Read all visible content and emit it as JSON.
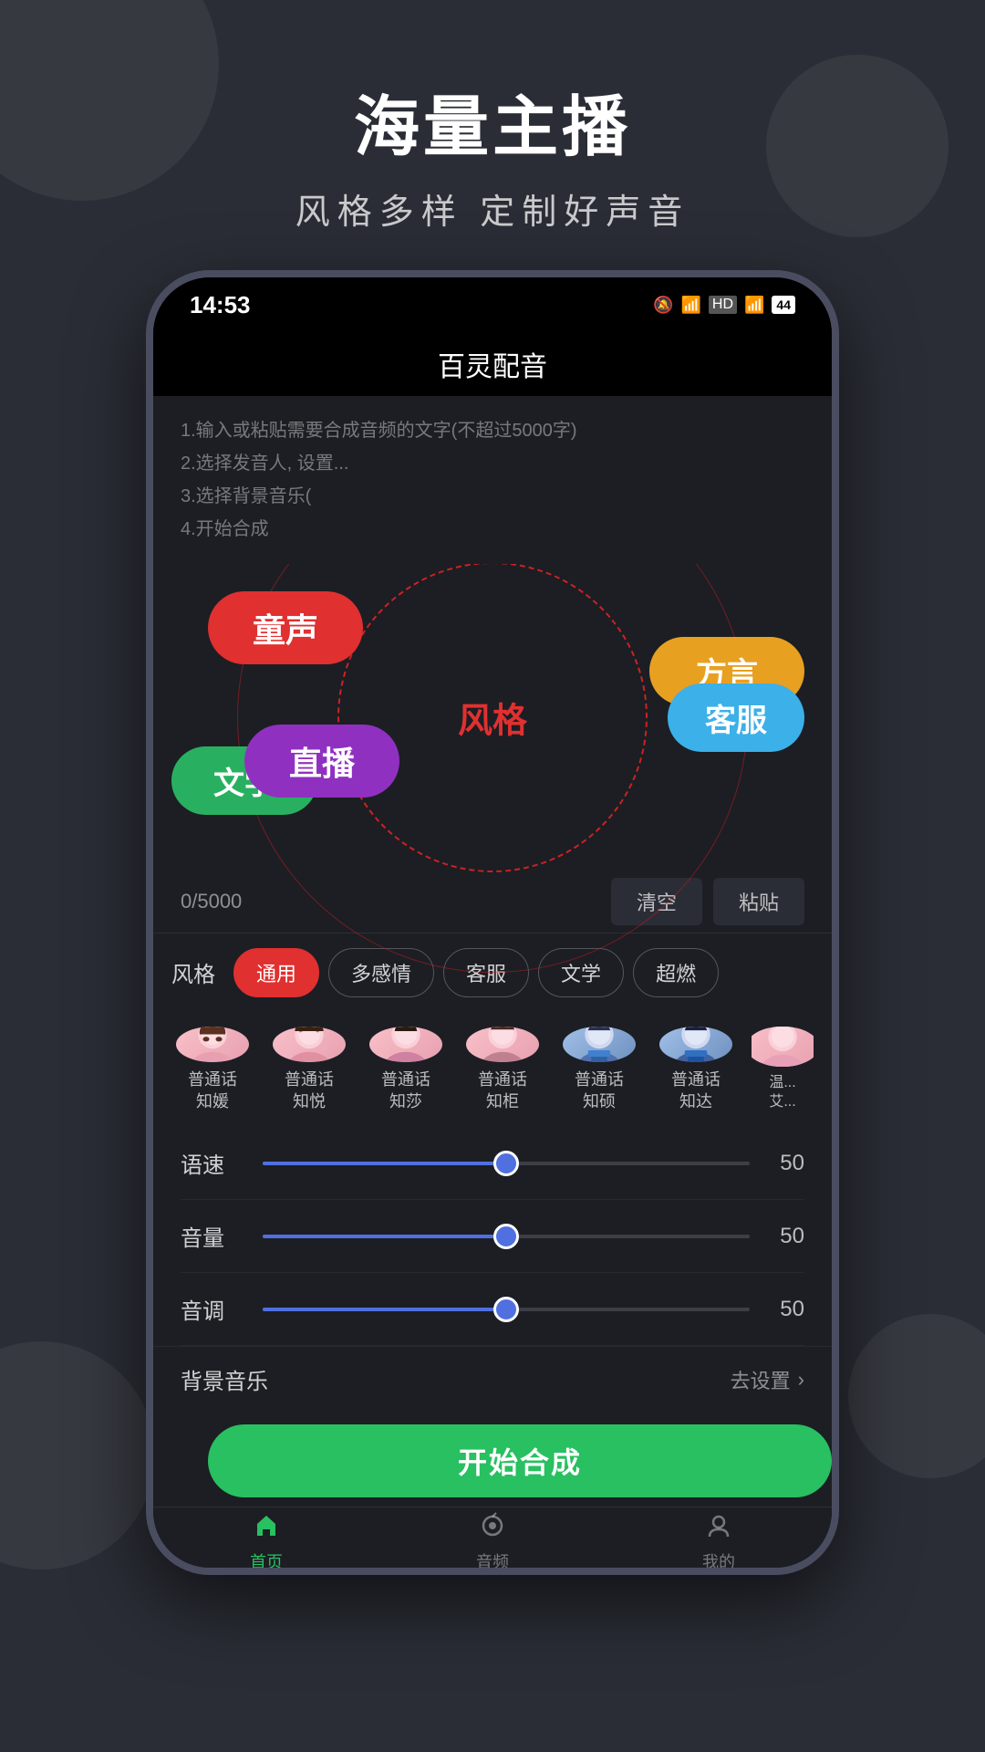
{
  "page": {
    "bg_title": "海量主播",
    "bg_subtitle": "风格多样  定制好声音"
  },
  "status_bar": {
    "time": "14:53",
    "icons": [
      "🔕",
      "📶",
      "HD",
      "4G",
      "44"
    ]
  },
  "app_header": {
    "title": "百灵配音"
  },
  "instructions": {
    "lines": [
      "1.输入或粘贴需要合成音频的文字(不超过5000字)",
      "2.选择发音人, 设...",
      "3.选择背景音乐(",
      "4.开始合成"
    ]
  },
  "style_wheel": {
    "center_label": "风格",
    "bubbles": [
      {
        "id": "tongsheng",
        "label": "童声",
        "color": "#e03030"
      },
      {
        "id": "fangyan",
        "label": "方言",
        "color": "#e8a020"
      },
      {
        "id": "wenxue",
        "label": "文学",
        "color": "#28b060"
      },
      {
        "id": "kefou",
        "label": "客服",
        "color": "#3cb0e8"
      },
      {
        "id": "zhibo",
        "label": "直播",
        "color": "#9030c0"
      }
    ]
  },
  "counter": {
    "value": "0/5000",
    "clear_label": "清空",
    "paste_label": "粘贴"
  },
  "style_filter": {
    "label": "风格",
    "chips": [
      {
        "id": "tongyong",
        "label": "通用",
        "active": true
      },
      {
        "id": "duogangqing",
        "label": "多感情",
        "active": false
      },
      {
        "id": "kefou",
        "label": "客服",
        "active": false
      },
      {
        "id": "wenxue",
        "label": "文学",
        "active": false
      },
      {
        "id": "chao",
        "label": "超燃",
        "active": false
      }
    ]
  },
  "voice_anchors": [
    {
      "id": "zhiyuan",
      "name": "普通话\n知媛",
      "gender": "female"
    },
    {
      "id": "zhiyue",
      "name": "普通话\n知悦",
      "gender": "female"
    },
    {
      "id": "zhisha",
      "name": "普通话\n知莎",
      "gender": "female"
    },
    {
      "id": "zhifu",
      "name": "普通话\n知柜",
      "gender": "female"
    },
    {
      "id": "zhishuo",
      "name": "普通话\n知硕",
      "gender": "male"
    },
    {
      "id": "zhida",
      "name": "普通话\n知达",
      "gender": "male"
    },
    {
      "id": "partial",
      "name": "温...\n艾...",
      "gender": "female",
      "partial": true
    }
  ],
  "sliders": [
    {
      "id": "speed",
      "label": "语速",
      "value": 50,
      "fill_pct": 50
    },
    {
      "id": "volume",
      "label": "音量",
      "value": 50,
      "fill_pct": 50
    },
    {
      "id": "pitch",
      "label": "音调",
      "value": 50,
      "fill_pct": 50
    }
  ],
  "bg_music": {
    "label": "背景音乐",
    "action": "去设置"
  },
  "start_button": {
    "label": "开始合成"
  },
  "bottom_nav": {
    "items": [
      {
        "id": "home",
        "label": "首页",
        "active": true,
        "icon": "⌂"
      },
      {
        "id": "audio",
        "label": "音频",
        "active": false,
        "icon": "♪"
      },
      {
        "id": "mine",
        "label": "我的",
        "active": false,
        "icon": "◎"
      }
    ]
  }
}
